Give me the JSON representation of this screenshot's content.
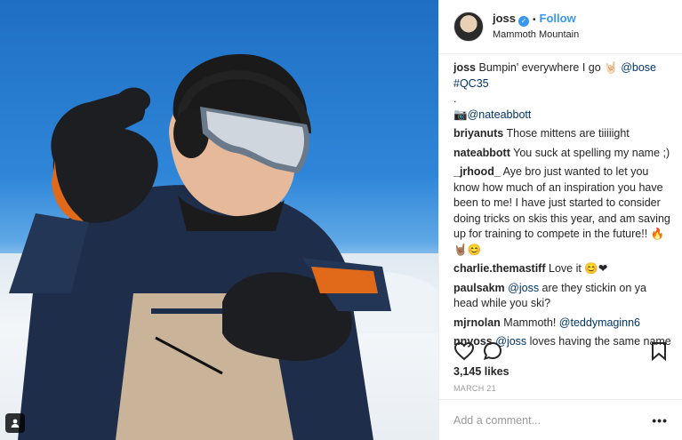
{
  "header": {
    "username": "joss",
    "follow_label": "Follow",
    "location": "Mammoth Mountain"
  },
  "caption": {
    "user": "joss",
    "text": "Bumpin' everywhere I go 🤘🏻 ",
    "mention": "@bose",
    "hashtag": "#QC35",
    "dot": ".",
    "credit": "📷@nateabbott"
  },
  "comments": [
    {
      "user": "briyanuts",
      "text": "Those mittens are tiiiiight"
    },
    {
      "user": "nateabbott",
      "text": "You suck at spelling my name ;)"
    },
    {
      "user": "_jrhood_",
      "text": "Aye bro just wanted to let you know how much of an inspiration you have been to me! I have just started to consider doing tricks on skis this year, and am saving up for training to compete in the future!! 🔥🤘🏽😊"
    },
    {
      "user": "charlie.themastiff",
      "text": "Love it 😊❤"
    },
    {
      "user": "paulsakm",
      "mention": "@joss",
      "text": " are they stickin on ya head while you ski?"
    },
    {
      "user": "mjrnolan",
      "text": "Mammoth! ",
      "mention": "@teddymaginn6"
    },
    {
      "user": "nnyoss",
      "mention": "@joss",
      "text": " loves having the same name"
    }
  ],
  "likes": "3,145 likes",
  "date": "MARCH 21",
  "add_comment_placeholder": "Add a comment...",
  "more_label": "•••",
  "icons": [
    "heart-icon",
    "comment-icon",
    "bookmark-icon",
    "user-tag-icon",
    "verified-badge-icon"
  ],
  "colors": {
    "accent": "#3897f0",
    "link": "#003569",
    "muted": "#999999"
  }
}
